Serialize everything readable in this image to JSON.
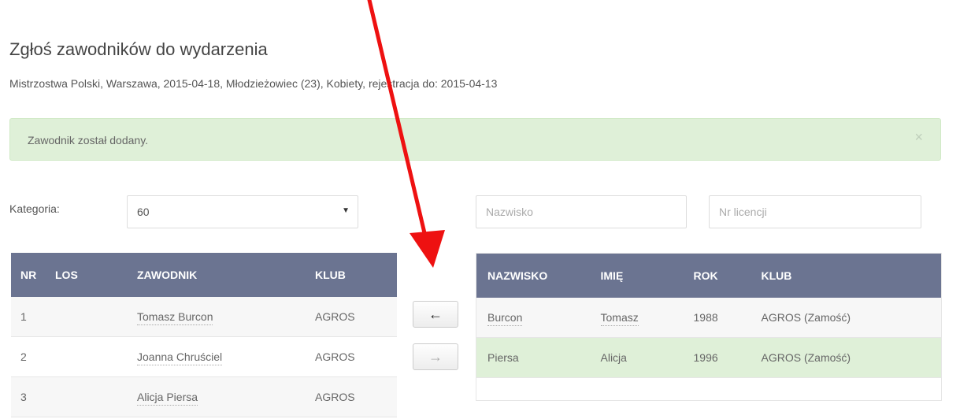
{
  "page": {
    "title": "Zgłoś zawodników do wydarzenia",
    "event_info": "Mistrzostwa Polski, Warszawa, 2015-04-18, Młodzieżowiec (23), Kobiety, rejestracja do: 2015-04-13"
  },
  "alert": {
    "message": "Zawodnik został dodany.",
    "close": "×"
  },
  "filters": {
    "category_label": "Kategoria:",
    "category_value": "60",
    "surname_placeholder": "Nazwisko",
    "license_placeholder": "Nr licencji"
  },
  "left_table": {
    "headers": [
      "NR",
      "LOS",
      "ZAWODNIK",
      "KLUB"
    ],
    "rows": [
      {
        "nr": "1",
        "los": "",
        "zawodnik": "Tomasz Burcon",
        "klub": "AGROS"
      },
      {
        "nr": "2",
        "los": "",
        "zawodnik": "Joanna Chruściel",
        "klub": "AGROS"
      },
      {
        "nr": "3",
        "los": "",
        "zawodnik": "Alicja Piersa",
        "klub": "AGROS"
      }
    ]
  },
  "buttons": {
    "move_left": "←",
    "move_right": "→"
  },
  "right_table": {
    "headers": [
      "NAZWISKO",
      "IMIĘ",
      "ROK",
      "KLUB"
    ],
    "rows": [
      {
        "nazwisko": "Burcon",
        "imie": "Tomasz",
        "rok": "1988",
        "klub": "AGROS (Zamość)"
      },
      {
        "nazwisko": "Piersa",
        "imie": "Alicja",
        "rok": "1996",
        "klub": "AGROS (Zamość)"
      }
    ]
  },
  "annotation": {
    "arrow_color": "#ee1111"
  }
}
